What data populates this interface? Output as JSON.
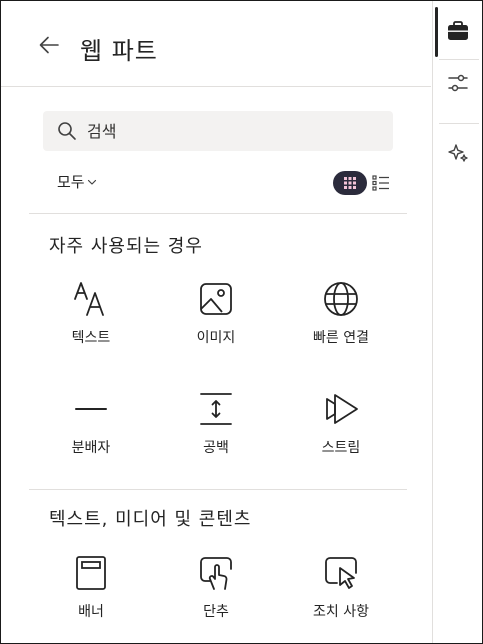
{
  "header": {
    "title": "웹 파트"
  },
  "search": {
    "placeholder": "검색"
  },
  "filter": {
    "label": "모두"
  },
  "sections": [
    {
      "title": "자주 사용되는 경우",
      "items": [
        {
          "label": "텍스트",
          "icon": "text-icon"
        },
        {
          "label": "이미지",
          "icon": "image-icon"
        },
        {
          "label": "빠른 연결",
          "icon": "globe-icon"
        },
        {
          "label": "분배자",
          "icon": "divider-icon"
        },
        {
          "label": "공백",
          "icon": "spacer-icon"
        },
        {
          "label": "스트림",
          "icon": "stream-icon"
        }
      ]
    },
    {
      "title": "텍스트, 미디어 및 콘텐츠",
      "items": [
        {
          "label": "배너",
          "icon": "banner-icon"
        },
        {
          "label": "단추",
          "icon": "button-icon"
        },
        {
          "label": "조치 사항",
          "icon": "call-to-action-icon"
        }
      ]
    }
  ],
  "rail": {
    "items": [
      "toolbox-icon",
      "settings-sliders-icon",
      "sparkle-icon"
    ]
  },
  "colors": {
    "accent": "#2b2b3c",
    "divider": "#e1dfdd",
    "search_bg": "#f3f2f1"
  }
}
